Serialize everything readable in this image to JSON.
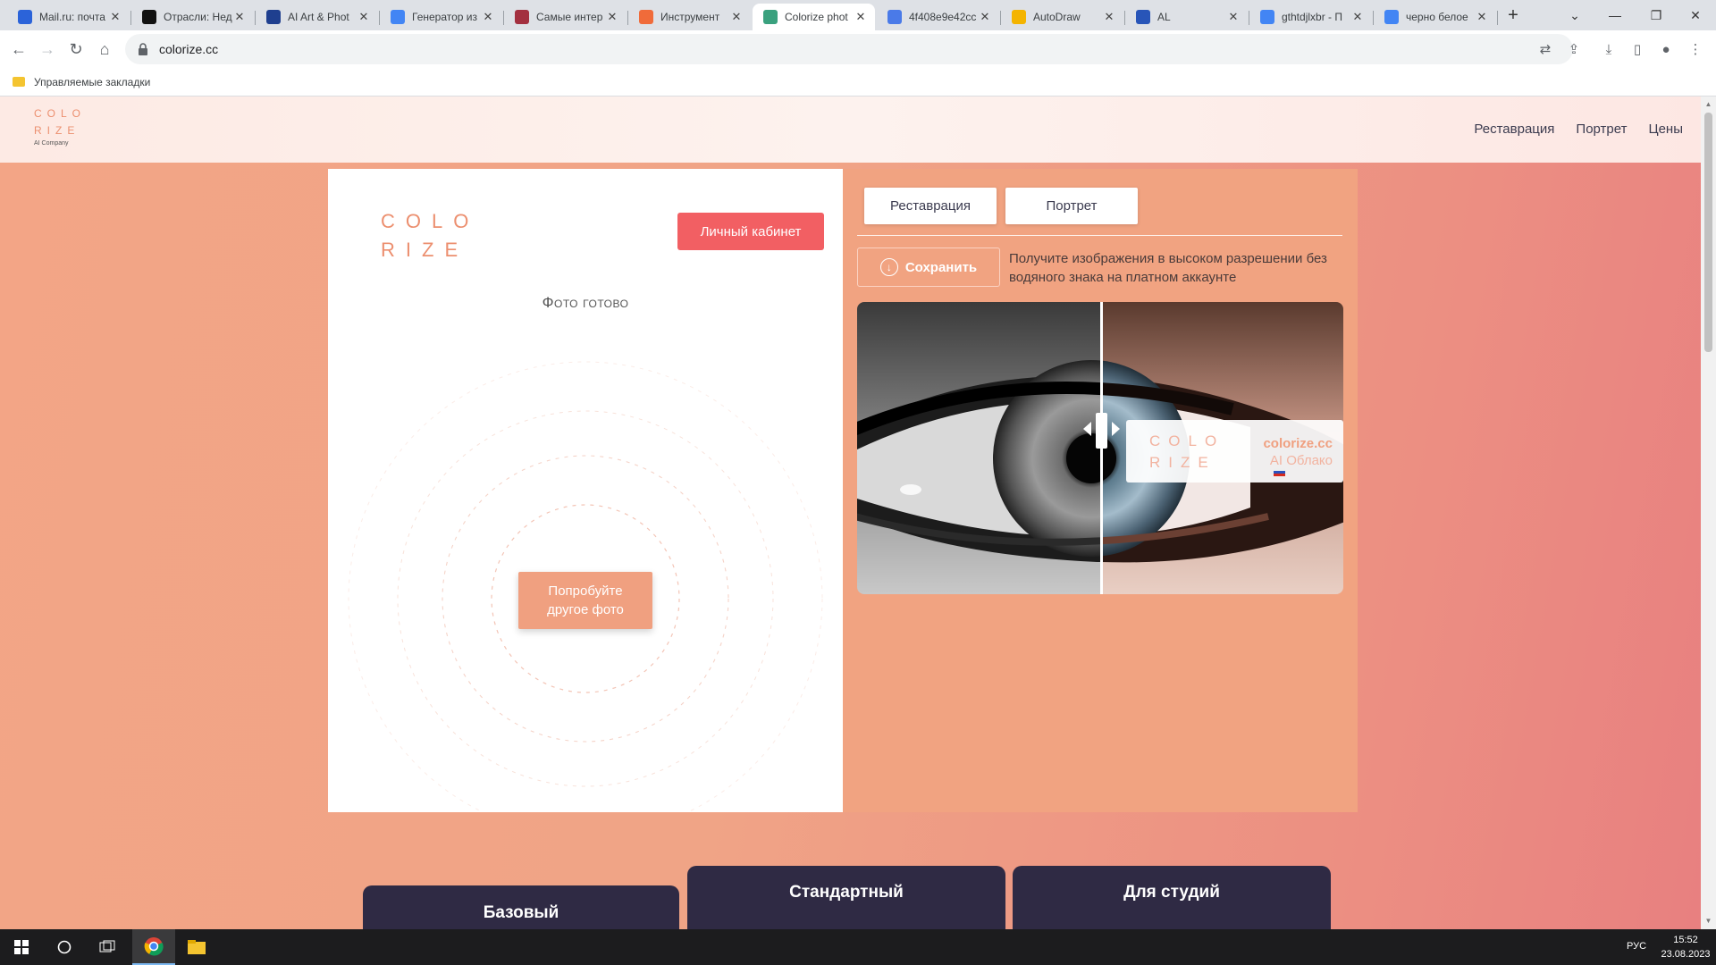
{
  "browser": {
    "tabs": [
      {
        "title": "Mail.ru: почта",
        "favicon": "mailru-icon",
        "color": "#2b63d9"
      },
      {
        "title": "Отрасли: Нед",
        "favicon": "b-icon",
        "color": "#111111"
      },
      {
        "title": "AI Art & Phot",
        "favicon": "ai-art-icon",
        "color": "#1f3f8f"
      },
      {
        "title": "Генератор из",
        "favicon": "google-icon",
        "color": "#4285f4"
      },
      {
        "title": "Самые интер",
        "favicon": "rb-icon",
        "color": "#a3303f"
      },
      {
        "title": "Инструмент",
        "favicon": "tool-icon",
        "color": "#f06b3a"
      },
      {
        "title": "Colorize phot",
        "favicon": "colorize-icon",
        "color": "#3aa17e",
        "active": true
      },
      {
        "title": "4f408e9e42cc",
        "favicon": "cloud-icon",
        "color": "#4a7ae8"
      },
      {
        "title": "AutoDraw",
        "favicon": "pencil-icon",
        "color": "#f4b400"
      },
      {
        "title": "AL",
        "favicon": "al-icon",
        "color": "#2855b8"
      },
      {
        "title": "gthtdjlxbr - П",
        "favicon": "google-icon",
        "color": "#4285f4"
      },
      {
        "title": "черно белое",
        "favicon": "google-icon",
        "color": "#4285f4"
      }
    ],
    "new_tab": "+",
    "url": "colorize.cc",
    "bookmarks_label": "Управляемые закладки"
  },
  "site": {
    "logo_small_line1": "COLO",
    "logo_small_line2": "RIZE",
    "logo_small_sub": "AI Company",
    "nav": [
      "Реставрация",
      "Портрет",
      "Цены"
    ],
    "card": {
      "logo_line1": "COLO",
      "logo_line2": "RIZE",
      "cabinet_button": "Личный кабинет",
      "status": "Фото готово",
      "try_button_line1": "Попробуйте",
      "try_button_line2": "другое фото"
    },
    "panel": {
      "tabs": [
        "Реставрация",
        "Портрет"
      ],
      "save_button": "Сохранить",
      "save_note": "Получите изображения в высоком разрешении без водяного знака на платном аккаунте",
      "watermark_logo_line1": "COLO",
      "watermark_logo_line2": "RIZE",
      "watermark_site": "colorize.cc",
      "watermark_cloud": "AI Облако"
    },
    "plans": [
      "Базовый",
      "Стандартный",
      "Для студий"
    ]
  },
  "taskbar": {
    "language": "РУС",
    "time": "15:52",
    "date": "23.08.2023"
  },
  "colors": {
    "accent": "#f25f63",
    "panel": "#f1a381",
    "plan_bg": "#2f2a44"
  }
}
